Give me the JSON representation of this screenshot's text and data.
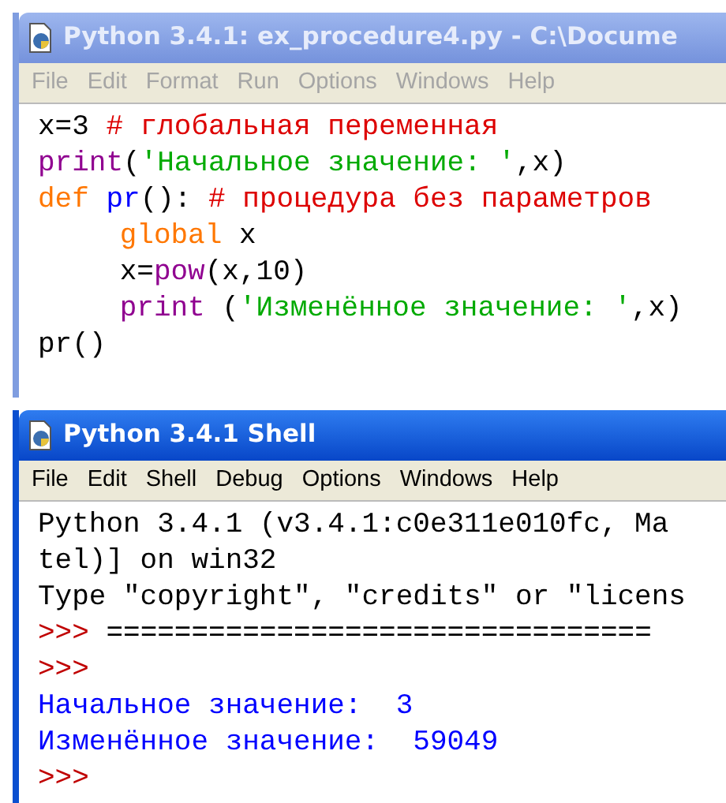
{
  "windows": [
    {
      "title": "Python 3.4.1: ex_procedure4.py - C:\\Docume",
      "active": false,
      "menu": [
        "File",
        "Edit",
        "Format",
        "Run",
        "Options",
        "Windows",
        "Help"
      ],
      "lines": [
        {
          "segments": [
            {
              "kind": "plain",
              "text": "x=3 "
            },
            {
              "kind": "comment",
              "text": "# глобальная переменная"
            }
          ]
        },
        {
          "segments": [
            {
              "kind": "builtin",
              "text": "print"
            },
            {
              "kind": "plain",
              "text": "("
            },
            {
              "kind": "string",
              "text": "'Начальное значение: '"
            },
            {
              "kind": "plain",
              "text": ",x)"
            }
          ]
        },
        {
          "segments": [
            {
              "kind": "keyword",
              "text": "def "
            },
            {
              "kind": "definition",
              "text": "pr"
            },
            {
              "kind": "plain",
              "text": "(): "
            },
            {
              "kind": "comment",
              "text": "# процедура без параметров"
            }
          ],
          "children": [
            {
              "segments": [
                {
                  "kind": "keyword",
                  "text": "global"
                },
                {
                  "kind": "plain",
                  "text": " x"
                }
              ]
            },
            {
              "segments": [
                {
                  "kind": "plain",
                  "text": "x="
                },
                {
                  "kind": "builtin",
                  "text": "pow"
                },
                {
                  "kind": "plain",
                  "text": "(x,10)"
                }
              ]
            },
            {
              "segments": [
                {
                  "kind": "builtin",
                  "text": "print"
                },
                {
                  "kind": "plain",
                  "text": " ("
                },
                {
                  "kind": "string",
                  "text": "'Изменённое значение: '"
                },
                {
                  "kind": "plain",
                  "text": ",x)"
                }
              ]
            }
          ]
        },
        {
          "segments": [
            {
              "kind": "plain",
              "text": "pr()"
            }
          ]
        }
      ]
    },
    {
      "title": "Python 3.4.1 Shell",
      "active": true,
      "menu": [
        "File",
        "Edit",
        "Shell",
        "Debug",
        "Options",
        "Windows",
        "Help"
      ],
      "lines": [
        {
          "segments": [
            {
              "kind": "plain",
              "text": "Python 3.4.1 (v3.4.1:c0e311e010fc, Ma"
            }
          ]
        },
        {
          "segments": [
            {
              "kind": "plain",
              "text": "tel)] on win32"
            }
          ]
        },
        {
          "segments": [
            {
              "kind": "plain",
              "text": "Type \"copyright\", \"credits\" or \"licens"
            }
          ]
        },
        {
          "segments": [
            {
              "kind": "prompt",
              "text": ">>> "
            },
            {
              "kind": "plain",
              "text": "================================"
            }
          ]
        },
        {
          "segments": [
            {
              "kind": "prompt",
              "text": ">>>"
            }
          ]
        },
        {
          "segments": [
            {
              "kind": "output",
              "text": "Начальное значение:  3"
            }
          ]
        },
        {
          "segments": [
            {
              "kind": "output",
              "text": "Изменённое значение:  59049"
            }
          ]
        },
        {
          "segments": [
            {
              "kind": "prompt",
              "text": ">>>"
            }
          ]
        }
      ]
    }
  ]
}
